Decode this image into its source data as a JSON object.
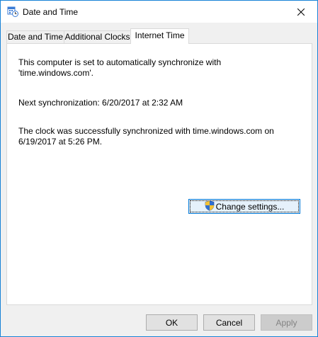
{
  "window": {
    "title": "Date and Time"
  },
  "tabs": [
    {
      "label": "Date and Time",
      "active": false
    },
    {
      "label": "Additional Clocks",
      "active": false
    },
    {
      "label": "Internet Time",
      "active": true
    }
  ],
  "internet_time": {
    "sync_line1": "This computer is set to automatically synchronize with",
    "sync_line2": "'time.windows.com'.",
    "next_sync": "Next synchronization: 6/20/2017 at 2:32 AM",
    "result_line1": "The clock was successfully synchronized with time.windows.com on",
    "result_line2": "6/19/2017 at 5:26 PM.",
    "change_settings_label": "Change settings..."
  },
  "buttons": {
    "ok": "OK",
    "cancel": "Cancel",
    "apply": "Apply"
  },
  "icons": {
    "title": "date-time-icon",
    "close": "close-icon",
    "shield": "uac-shield-icon"
  },
  "colors": {
    "accent": "#0078d7",
    "window_border": "#1883d7",
    "disabled_text": "#838383"
  }
}
